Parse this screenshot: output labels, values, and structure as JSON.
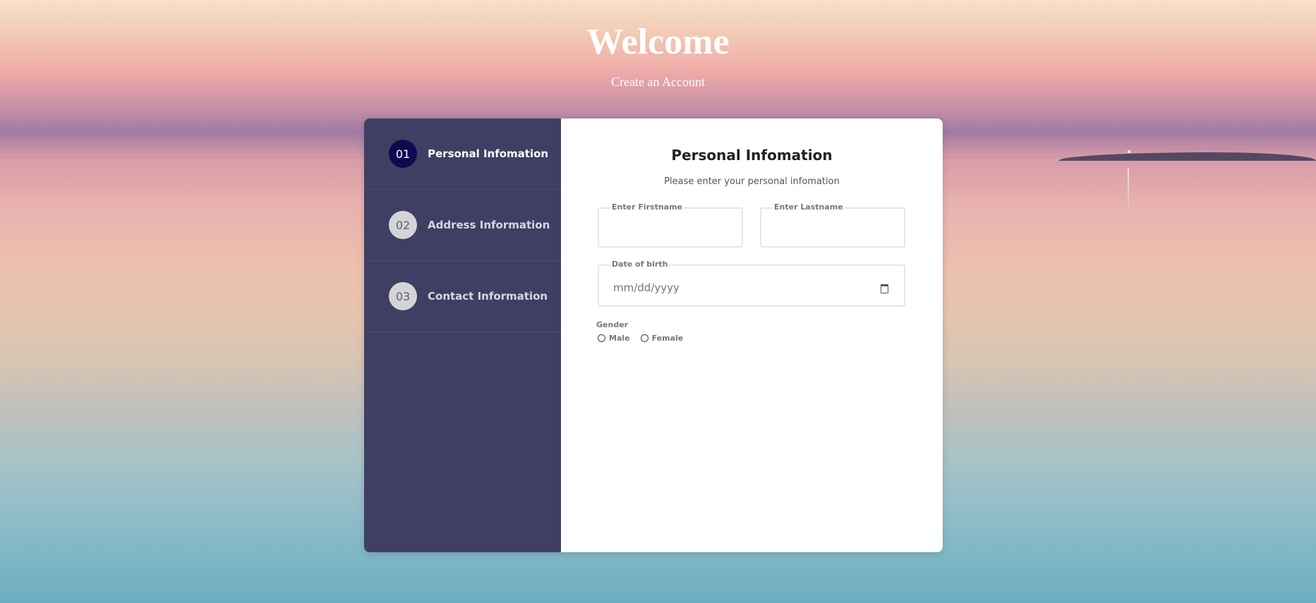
{
  "header": {
    "title": "Welcome",
    "subtitle": "Create an Account"
  },
  "steps": [
    {
      "number": "01",
      "label": "Personal Infomation",
      "active": true
    },
    {
      "number": "02",
      "label": "Address Information",
      "active": false
    },
    {
      "number": "03",
      "label": "Contact Information",
      "active": false
    }
  ],
  "form": {
    "title": "Personal Infomation",
    "subtitle": "Please enter your personal infomation",
    "firstname_legend": "Enter Firstname",
    "firstname_value": "",
    "lastname_legend": "Enter Lastname",
    "lastname_value": "",
    "dob_legend": "Date of birth",
    "dob_placeholder": "mm/dd/yyyy",
    "gender_label": "Gender",
    "gender_options": [
      "Male",
      "Female"
    ]
  },
  "colors": {
    "sidebar_bg": "#3f3f63",
    "active_step": "#0d0a4f",
    "inactive_step": "#d4d4d8"
  }
}
